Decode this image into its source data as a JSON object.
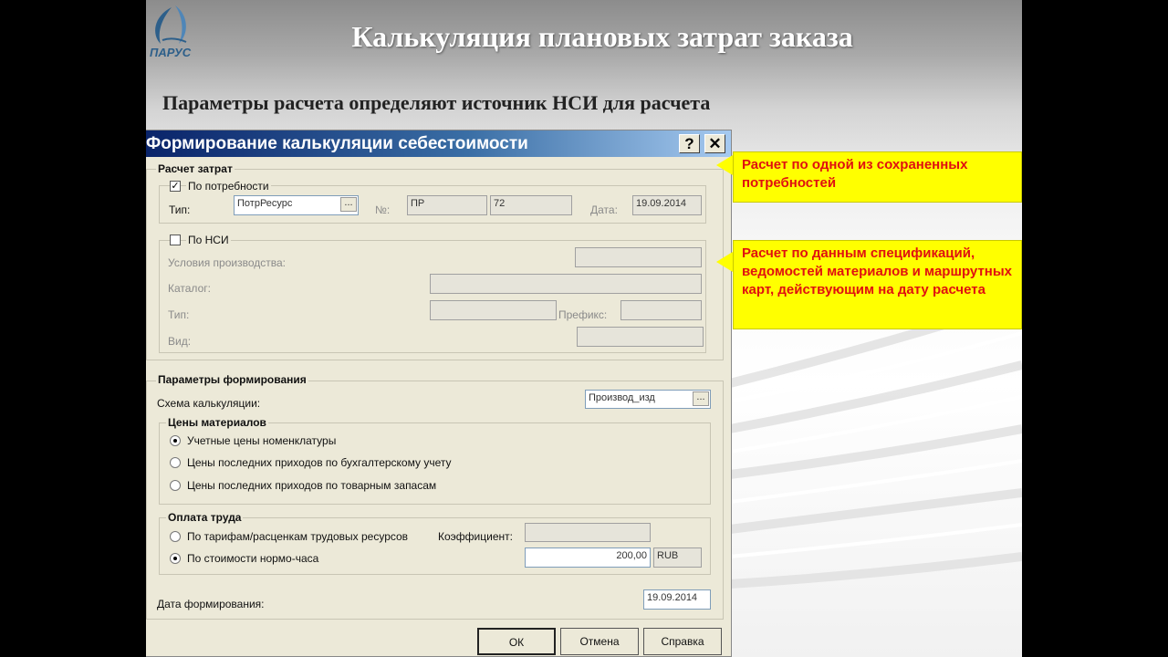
{
  "slide": {
    "logo_text": "ПАРУС",
    "title": "Калькуляция плановых затрат заказа",
    "subtitle": "Параметры расчета определяют источник  НСИ для расчета"
  },
  "dialog": {
    "title": "Формирование калькуляции себестоимости",
    "help_button": "?",
    "close_button": "✕",
    "cost_calc": {
      "group_label": "Расчет затрат",
      "by_demand": {
        "label": "По потребности",
        "checked": "✓",
        "type_label": "Тип:",
        "type_value": "ПотрРесурс",
        "number_label": "№:",
        "number_prefix": "ПР",
        "number_value": "72",
        "date_label": "Дата:",
        "date_value": "19.09.2014"
      },
      "by_nsi": {
        "label": "По НСИ",
        "conditions_label": "Условия производства:",
        "catalog_label": "Каталог:",
        "type_label": "Тип:",
        "prefix_label": "Префикс:",
        "kind_label": "Вид:"
      }
    },
    "gen_params": {
      "group_label": "Параметры формирования",
      "scheme_label": "Схема калькуляции:",
      "scheme_value": "Производ_изд",
      "material_prices": {
        "group_label": "Цены материалов",
        "options": [
          "Учетные цены номенклатуры",
          "Цены последних приходов по бухгалтерскому учету",
          "Цены последних приходов по товарным запасам"
        ]
      },
      "labor": {
        "group_label": "Оплата труда",
        "options": [
          "По тарифам/расценкам трудовых ресурсов",
          "По стоимости нормо-часа"
        ],
        "coef_label": "Коэффициент:",
        "amount": "200,00",
        "currency": "RUB"
      },
      "date_label": "Дата формирования:",
      "date_value": "19.09.2014"
    },
    "buttons": {
      "ok": "ОК",
      "cancel": "Отмена",
      "help": "Справка"
    }
  },
  "callouts": {
    "saved_demand": "Расчет по одной из сохраненных потребностей",
    "spec_data": "Расчет по данным спецификаций, ведомостей материалов и маршрутных карт, действующим на дату расчета"
  }
}
